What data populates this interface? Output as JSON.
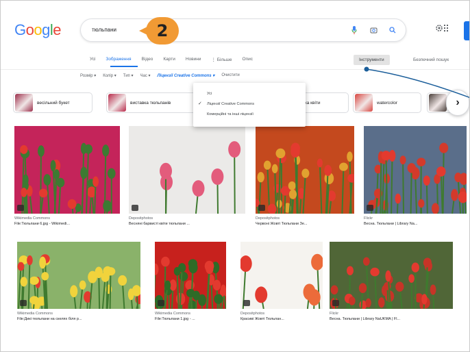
{
  "header": {
    "logo": "Google",
    "search_query": "тюльпани",
    "step_badge": "2"
  },
  "tabs": [
    {
      "label": "Усі",
      "active": false
    },
    {
      "label": "Зображення",
      "active": true
    },
    {
      "label": "Відео",
      "active": false
    },
    {
      "label": "Карти",
      "active": false
    },
    {
      "label": "Новини",
      "active": false
    },
    {
      "label": "⋮ Більше",
      "active": false
    },
    {
      "label": "Опис",
      "active": false
    }
  ],
  "tools_label": "Інструменти",
  "safe_search_label": "Безпечний пошук",
  "filters": [
    {
      "label": "Розмір ▾",
      "active": false
    },
    {
      "label": "Колір ▾",
      "active": false
    },
    {
      "label": "Тип ▾",
      "active": false
    },
    {
      "label": "Час ▾",
      "active": false
    },
    {
      "label": "Ліцензії Creative Commons ▾",
      "active": true
    },
    {
      "label": "Очистити",
      "active": false
    }
  ],
  "license_dropdown": {
    "items": [
      {
        "label": "Усі",
        "checked": false
      },
      {
        "label": "Ліцензії Creative Commons",
        "checked": true
      },
      {
        "label": "Комерційні та інші ліцензії",
        "checked": false
      }
    ]
  },
  "chips": [
    {
      "label": "весільний букет",
      "color": "#9b2e4b"
    },
    {
      "label": "виставка тюльпанів",
      "color": "#b82a4a"
    },
    {
      "label": "банка квіти",
      "color": "#c23a3a"
    },
    {
      "label": "watercolor",
      "color": "#d8453f"
    },
    {
      "label": "",
      "color": "#4a3f3a"
    }
  ],
  "chip_next": "›",
  "images": [
    {
      "source": "Wikimedia Commons",
      "title": "File:Тюльпани 6.jpg - Wikimedi...",
      "bg": "#c4245a",
      "accent": "#3d7a32"
    },
    {
      "source": "Depositphotos",
      "title": "Весняні барвисті квіти тюльпани ...",
      "bg": "#ebeae8",
      "accent": "#e35c7c"
    },
    {
      "source": "Depositphotos",
      "title": "Червоні Жовті Тюльпани Зе...",
      "bg": "#c4491e",
      "accent": "#e1a230"
    },
    {
      "source": "Flickr",
      "title": "Весна. Тюльпани | Library Na...",
      "bg": "#5a6e8a",
      "accent": "#d33a2b"
    },
    {
      "source": "Wikimedia Commons",
      "title": "File:Дикі тюльпани на скелях біля р...",
      "bg": "#8ab26a",
      "accent": "#f1d33c"
    },
    {
      "source": "Wikimedia Commons",
      "title": "File:Тюльпани 1.jpg - ...",
      "bg": "#c7211d",
      "accent": "#2e6b27"
    },
    {
      "source": "Depositphotos",
      "title": "Красиві Жовті Тюльпан...",
      "bg": "#f5f3ef",
      "accent": "#ec6b3a"
    },
    {
      "source": "Flickr",
      "title": "Весна. Тюльпани | Library NaUKMA | Fl...",
      "bg": "#506637",
      "accent": "#c73427"
    }
  ],
  "colors": {
    "accent": "#1a73e8",
    "badge": "#f19a34",
    "annotation_line": "#1b5e9a"
  }
}
